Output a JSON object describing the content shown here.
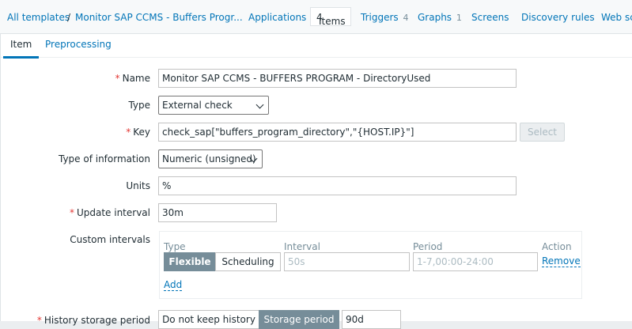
{
  "breadcrumb": {
    "all_templates": "All templates",
    "separator": "/",
    "template_name": "Monitor SAP CCMS - Buffers Progr..."
  },
  "nav": {
    "applications": "Applications",
    "items": "Items",
    "items_count": "4",
    "triggers": "Triggers",
    "triggers_count": "4",
    "graphs": "Graphs",
    "graphs_count": "1",
    "screens": "Screens",
    "discovery_rules": "Discovery rules",
    "web": "Web sc"
  },
  "tabs": {
    "item": "Item",
    "preprocessing": "Preprocessing"
  },
  "form": {
    "name": {
      "label": "Name",
      "value": "Monitor SAP CCMS - BUFFERS PROGRAM - DirectoryUsed"
    },
    "type": {
      "label": "Type",
      "value": "External check"
    },
    "key": {
      "label": "Key",
      "value": "check_sap[\"buffers_program_directory\",\"{HOST.IP}\"]",
      "select_label": "Select"
    },
    "type_of_information": {
      "label": "Type of information",
      "value": "Numeric (unsigned)"
    },
    "units": {
      "label": "Units",
      "value": "%"
    },
    "update_interval": {
      "label": "Update interval",
      "value": "30m"
    },
    "custom_intervals": {
      "label": "Custom intervals",
      "col_type": "Type",
      "col_interval": "Interval",
      "col_period": "Period",
      "col_action": "Action",
      "flexible": "Flexible",
      "scheduling": "Scheduling",
      "interval_placeholder": "50s",
      "period_placeholder": "1-7,00:00-24:00",
      "remove": "Remove",
      "add": "Add"
    },
    "history": {
      "label": "History storage period",
      "do_not_keep": "Do not keep history",
      "storage_period": "Storage period",
      "value": "90d"
    }
  },
  "colors": {
    "link": "#0275b8",
    "required": "#e33734",
    "segment_active": "#768d99"
  }
}
